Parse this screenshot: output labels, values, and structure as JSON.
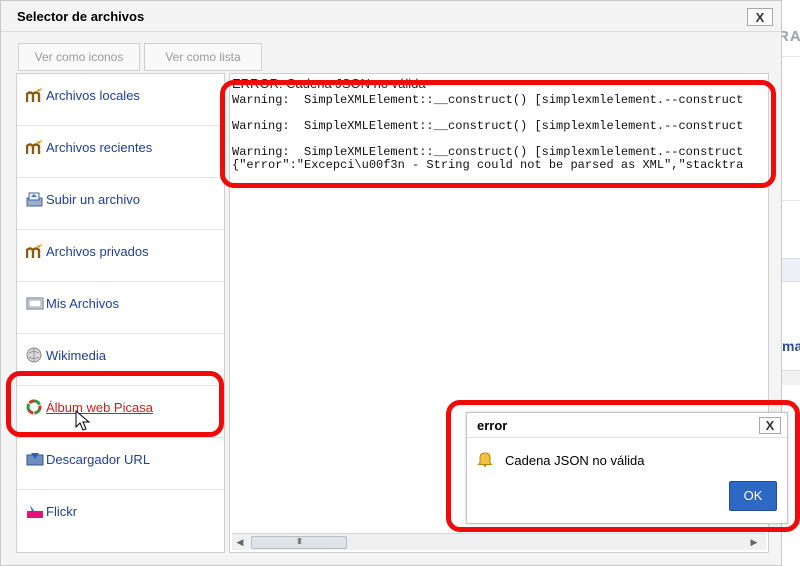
{
  "background_page": {
    "fragment_top": "RA",
    "fragment_mid": "ma"
  },
  "dialog": {
    "title": "Selector de archivos",
    "close_label": "X"
  },
  "view_buttons": {
    "icons_label": "Ver como iconos",
    "list_label": "Ver como lista"
  },
  "sidebar": {
    "items": [
      {
        "label": "Archivos locales",
        "icon": "moodle-icon"
      },
      {
        "label": "Archivos recientes",
        "icon": "moodle-icon"
      },
      {
        "label": "Subir un archivo",
        "icon": "upload-icon"
      },
      {
        "label": "Archivos privados",
        "icon": "moodle-icon"
      },
      {
        "label": "Mis Archivos",
        "icon": "folder-icon"
      },
      {
        "label": "Wikimedia",
        "icon": "wikimedia-icon"
      },
      {
        "label": "Álbum web Picasa",
        "icon": "picasa-icon",
        "active": true
      },
      {
        "label": "Descargador URL",
        "icon": "url-download-icon"
      },
      {
        "label": "Flickr",
        "icon": "flickr-icon"
      }
    ]
  },
  "content": {
    "error_header": "ERROR: Cadena JSON no válida",
    "warning_lines": [
      "Warning:  SimpleXMLElement::__construct() [simplexmlelement.--construct",
      "Warning:  SimpleXMLElement::__construct() [simplexmlelement.--construct",
      "Warning:  SimpleXMLElement::__construct() [simplexmlelement.--construct"
    ],
    "json_line": "{\"error\":\"Excepci\\u00f3n - String could not be parsed as XML\",\"stacktra",
    "scroll_thumb_label": "III"
  },
  "error_modal": {
    "title": "error",
    "close_label": "X",
    "message": "Cadena JSON no válida",
    "ok_label": "OK"
  },
  "colors": {
    "highlight": "#f00a0a",
    "link": "#1f3f9a",
    "active_link": "#c8221c",
    "ok_button": "#2d68c4"
  }
}
